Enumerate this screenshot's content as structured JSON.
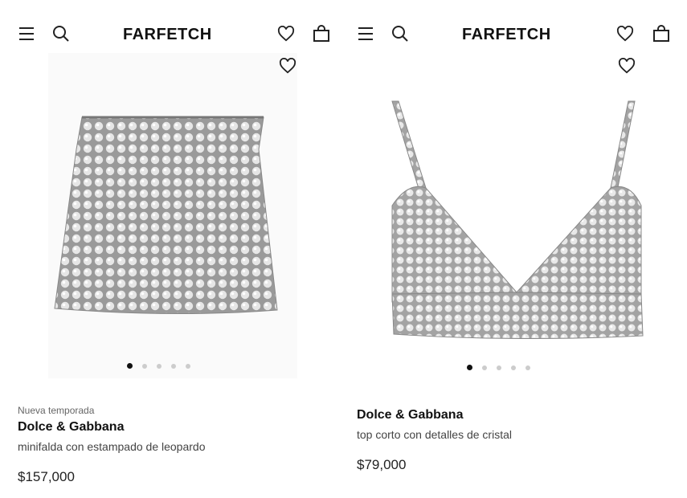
{
  "colors": {
    "text": "#222222",
    "muted": "#666666",
    "dot_inactive": "#cccccc",
    "dot_active": "#111111"
  },
  "panels": [
    {
      "header": {
        "logo": "FARFETCH",
        "icons": [
          "menu-icon",
          "search-icon",
          "heart-icon",
          "bag-icon"
        ]
      },
      "product": {
        "badge": "Nueva temporada",
        "brand": "Dolce & Gabbana",
        "description": "minifalda con estampado de leopardo",
        "price": "$157,000",
        "image_index": 1,
        "image_count": 5
      }
    },
    {
      "header": {
        "logo": "FARFETCH",
        "icons": [
          "menu-icon",
          "search-icon",
          "heart-icon",
          "bag-icon"
        ]
      },
      "product": {
        "badge": "",
        "brand": "Dolce & Gabbana",
        "description": "top corto con detalles de cristal",
        "price": "$79,000",
        "image_index": 1,
        "image_count": 5
      }
    }
  ]
}
